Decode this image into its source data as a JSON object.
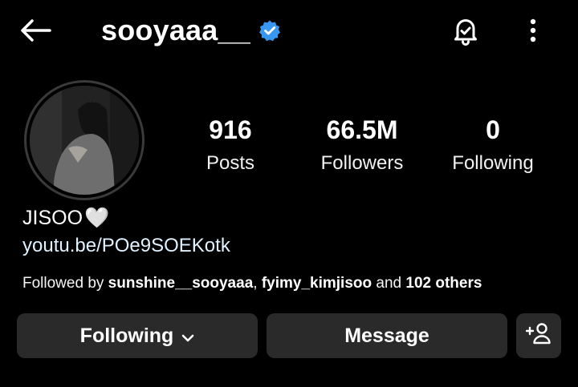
{
  "header": {
    "username": "sooyaaa__",
    "icons": {
      "back": "arrow-left-icon",
      "verified": "verified-badge-icon",
      "notifications": "bell-icon",
      "more": "more-vertical-icon"
    }
  },
  "stats": {
    "posts": {
      "value": "916",
      "label": "Posts"
    },
    "followers": {
      "value": "66.5M",
      "label": "Followers"
    },
    "following": {
      "value": "0",
      "label": "Following"
    }
  },
  "bio": {
    "name": "JISOO",
    "emoji": "🤍",
    "link": "youtu.be/POe9SOEKotk"
  },
  "followed_by": {
    "prefix": "Followed by ",
    "user1": "sunshine__sooyaaa",
    "separator": ", ",
    "user2": "fyimy_kimjisoo",
    "and": " and ",
    "others": "102 others"
  },
  "actions": {
    "following_label": "Following",
    "message_label": "Message"
  },
  "colors": {
    "background": "#000000",
    "button_bg": "#2a2a2a",
    "verified_blue": "#3897f0",
    "text": "#ffffff"
  }
}
